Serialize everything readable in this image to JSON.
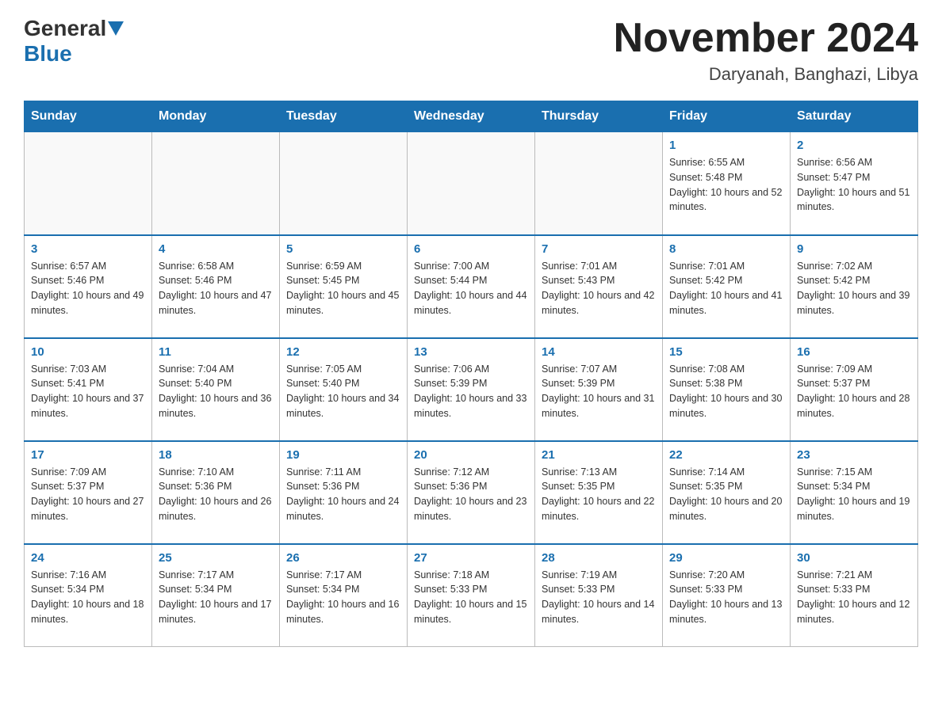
{
  "header": {
    "logo_general": "General",
    "logo_blue": "Blue",
    "month_title": "November 2024",
    "location": "Daryanah, Banghazi, Libya"
  },
  "days_of_week": [
    "Sunday",
    "Monday",
    "Tuesday",
    "Wednesday",
    "Thursday",
    "Friday",
    "Saturday"
  ],
  "weeks": [
    [
      {
        "day": "",
        "sunrise": "",
        "sunset": "",
        "daylight": ""
      },
      {
        "day": "",
        "sunrise": "",
        "sunset": "",
        "daylight": ""
      },
      {
        "day": "",
        "sunrise": "",
        "sunset": "",
        "daylight": ""
      },
      {
        "day": "",
        "sunrise": "",
        "sunset": "",
        "daylight": ""
      },
      {
        "day": "",
        "sunrise": "",
        "sunset": "",
        "daylight": ""
      },
      {
        "day": "1",
        "sunrise": "Sunrise: 6:55 AM",
        "sunset": "Sunset: 5:48 PM",
        "daylight": "Daylight: 10 hours and 52 minutes."
      },
      {
        "day": "2",
        "sunrise": "Sunrise: 6:56 AM",
        "sunset": "Sunset: 5:47 PM",
        "daylight": "Daylight: 10 hours and 51 minutes."
      }
    ],
    [
      {
        "day": "3",
        "sunrise": "Sunrise: 6:57 AM",
        "sunset": "Sunset: 5:46 PM",
        "daylight": "Daylight: 10 hours and 49 minutes."
      },
      {
        "day": "4",
        "sunrise": "Sunrise: 6:58 AM",
        "sunset": "Sunset: 5:46 PM",
        "daylight": "Daylight: 10 hours and 47 minutes."
      },
      {
        "day": "5",
        "sunrise": "Sunrise: 6:59 AM",
        "sunset": "Sunset: 5:45 PM",
        "daylight": "Daylight: 10 hours and 45 minutes."
      },
      {
        "day": "6",
        "sunrise": "Sunrise: 7:00 AM",
        "sunset": "Sunset: 5:44 PM",
        "daylight": "Daylight: 10 hours and 44 minutes."
      },
      {
        "day": "7",
        "sunrise": "Sunrise: 7:01 AM",
        "sunset": "Sunset: 5:43 PM",
        "daylight": "Daylight: 10 hours and 42 minutes."
      },
      {
        "day": "8",
        "sunrise": "Sunrise: 7:01 AM",
        "sunset": "Sunset: 5:42 PM",
        "daylight": "Daylight: 10 hours and 41 minutes."
      },
      {
        "day": "9",
        "sunrise": "Sunrise: 7:02 AM",
        "sunset": "Sunset: 5:42 PM",
        "daylight": "Daylight: 10 hours and 39 minutes."
      }
    ],
    [
      {
        "day": "10",
        "sunrise": "Sunrise: 7:03 AM",
        "sunset": "Sunset: 5:41 PM",
        "daylight": "Daylight: 10 hours and 37 minutes."
      },
      {
        "day": "11",
        "sunrise": "Sunrise: 7:04 AM",
        "sunset": "Sunset: 5:40 PM",
        "daylight": "Daylight: 10 hours and 36 minutes."
      },
      {
        "day": "12",
        "sunrise": "Sunrise: 7:05 AM",
        "sunset": "Sunset: 5:40 PM",
        "daylight": "Daylight: 10 hours and 34 minutes."
      },
      {
        "day": "13",
        "sunrise": "Sunrise: 7:06 AM",
        "sunset": "Sunset: 5:39 PM",
        "daylight": "Daylight: 10 hours and 33 minutes."
      },
      {
        "day": "14",
        "sunrise": "Sunrise: 7:07 AM",
        "sunset": "Sunset: 5:39 PM",
        "daylight": "Daylight: 10 hours and 31 minutes."
      },
      {
        "day": "15",
        "sunrise": "Sunrise: 7:08 AM",
        "sunset": "Sunset: 5:38 PM",
        "daylight": "Daylight: 10 hours and 30 minutes."
      },
      {
        "day": "16",
        "sunrise": "Sunrise: 7:09 AM",
        "sunset": "Sunset: 5:37 PM",
        "daylight": "Daylight: 10 hours and 28 minutes."
      }
    ],
    [
      {
        "day": "17",
        "sunrise": "Sunrise: 7:09 AM",
        "sunset": "Sunset: 5:37 PM",
        "daylight": "Daylight: 10 hours and 27 minutes."
      },
      {
        "day": "18",
        "sunrise": "Sunrise: 7:10 AM",
        "sunset": "Sunset: 5:36 PM",
        "daylight": "Daylight: 10 hours and 26 minutes."
      },
      {
        "day": "19",
        "sunrise": "Sunrise: 7:11 AM",
        "sunset": "Sunset: 5:36 PM",
        "daylight": "Daylight: 10 hours and 24 minutes."
      },
      {
        "day": "20",
        "sunrise": "Sunrise: 7:12 AM",
        "sunset": "Sunset: 5:36 PM",
        "daylight": "Daylight: 10 hours and 23 minutes."
      },
      {
        "day": "21",
        "sunrise": "Sunrise: 7:13 AM",
        "sunset": "Sunset: 5:35 PM",
        "daylight": "Daylight: 10 hours and 22 minutes."
      },
      {
        "day": "22",
        "sunrise": "Sunrise: 7:14 AM",
        "sunset": "Sunset: 5:35 PM",
        "daylight": "Daylight: 10 hours and 20 minutes."
      },
      {
        "day": "23",
        "sunrise": "Sunrise: 7:15 AM",
        "sunset": "Sunset: 5:34 PM",
        "daylight": "Daylight: 10 hours and 19 minutes."
      }
    ],
    [
      {
        "day": "24",
        "sunrise": "Sunrise: 7:16 AM",
        "sunset": "Sunset: 5:34 PM",
        "daylight": "Daylight: 10 hours and 18 minutes."
      },
      {
        "day": "25",
        "sunrise": "Sunrise: 7:17 AM",
        "sunset": "Sunset: 5:34 PM",
        "daylight": "Daylight: 10 hours and 17 minutes."
      },
      {
        "day": "26",
        "sunrise": "Sunrise: 7:17 AM",
        "sunset": "Sunset: 5:34 PM",
        "daylight": "Daylight: 10 hours and 16 minutes."
      },
      {
        "day": "27",
        "sunrise": "Sunrise: 7:18 AM",
        "sunset": "Sunset: 5:33 PM",
        "daylight": "Daylight: 10 hours and 15 minutes."
      },
      {
        "day": "28",
        "sunrise": "Sunrise: 7:19 AM",
        "sunset": "Sunset: 5:33 PM",
        "daylight": "Daylight: 10 hours and 14 minutes."
      },
      {
        "day": "29",
        "sunrise": "Sunrise: 7:20 AM",
        "sunset": "Sunset: 5:33 PM",
        "daylight": "Daylight: 10 hours and 13 minutes."
      },
      {
        "day": "30",
        "sunrise": "Sunrise: 7:21 AM",
        "sunset": "Sunset: 5:33 PM",
        "daylight": "Daylight: 10 hours and 12 minutes."
      }
    ]
  ]
}
